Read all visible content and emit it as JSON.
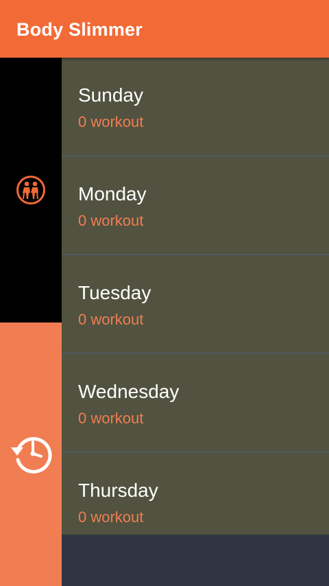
{
  "app": {
    "title": "Body Slimmer"
  },
  "colors": {
    "accent": "#f26a36",
    "accent_soft": "#f07e52",
    "list_bg": "#51523f",
    "divider": "#4e5a5c",
    "footer_bg": "#2f3542"
  },
  "sidebar": {
    "items": [
      {
        "icon": "workout-couple-icon",
        "selected": true
      },
      {
        "icon": "history-clock-icon",
        "selected": false
      }
    ]
  },
  "days": [
    {
      "name": "Sunday",
      "count": "0 workout"
    },
    {
      "name": "Monday",
      "count": "0 workout"
    },
    {
      "name": "Tuesday",
      "count": "0 workout"
    },
    {
      "name": "Wednesday",
      "count": "0 workout"
    },
    {
      "name": "Thursday",
      "count": "0 workout"
    }
  ]
}
